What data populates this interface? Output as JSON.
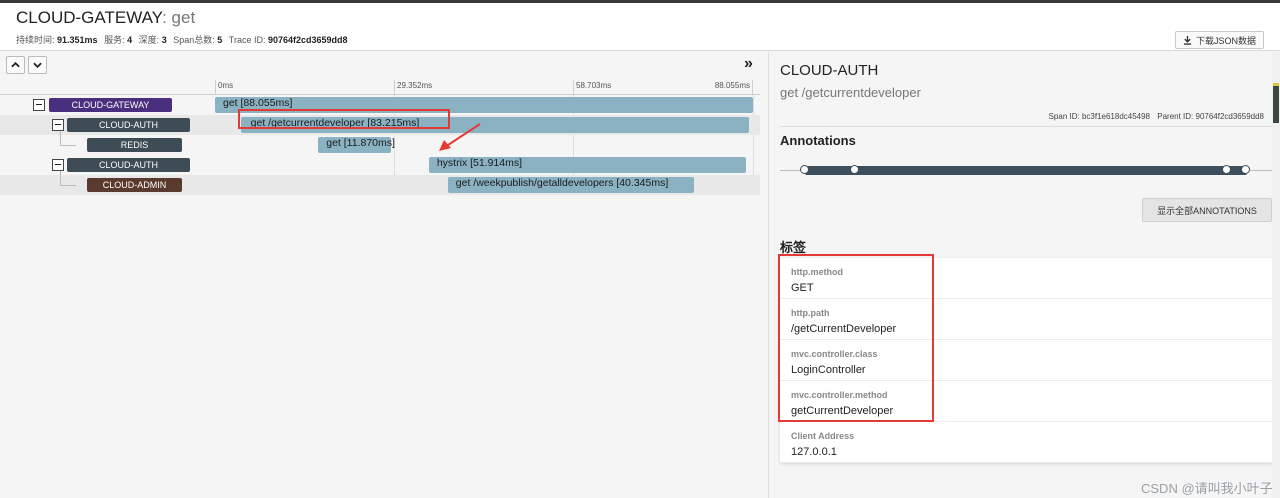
{
  "header": {
    "service": "CLOUD-GATEWAY",
    "operation": ": get",
    "info": [
      {
        "label": "持续时间:",
        "value": "91.351ms"
      },
      {
        "label": "服务:",
        "value": "4"
      },
      {
        "label": "深度:",
        "value": "3"
      },
      {
        "label": "Span总数:",
        "value": "5"
      },
      {
        "label": "Trace ID:",
        "value": "90764f2cd3659dd8"
      }
    ],
    "download_label": "下载JSON数据"
  },
  "timeline": {
    "expand_glyph": "»",
    "ticks": [
      "0ms",
      "29.352ms",
      "58.703ms",
      "88.055ms"
    ],
    "total_ms": 88.055
  },
  "spans": [
    {
      "service": "CLOUD-GATEWAY",
      "color": "#4b2f7f",
      "label": "get [88.055ms]",
      "start_ms": 0,
      "duration_ms": 88.055,
      "depth": 0,
      "collapsible": true
    },
    {
      "service": "CLOUD-AUTH",
      "color": "#3e4c56",
      "label": "get /getcurrentdeveloper [83.215ms]",
      "start_ms": 4.2,
      "duration_ms": 83.215,
      "depth": 1,
      "collapsible": true
    },
    {
      "service": "REDIS",
      "color": "#3e4c56",
      "label": "get [11.870ms]",
      "start_ms": 16.9,
      "duration_ms": 11.87,
      "depth": 2,
      "collapsible": false
    },
    {
      "service": "CLOUD-AUTH",
      "color": "#3e4c56",
      "label": "hystrix [51.914ms]",
      "start_ms": 35.0,
      "duration_ms": 51.914,
      "depth": 1,
      "collapsible": true
    },
    {
      "service": "CLOUD-ADMIN",
      "color": "#5b3a2e",
      "label": "get /weekpublish/getalldevelopers [40.345ms]",
      "start_ms": 38.1,
      "duration_ms": 40.345,
      "depth": 2,
      "collapsible": false
    }
  ],
  "detail": {
    "service": "CLOUD-AUTH",
    "operation": "get /getcurrentdeveloper",
    "span_id": "Span ID: bc3f1e618dc45498",
    "parent_id": "Parent ID: 90764f2cd3659dd8",
    "annotations_heading": "Annotations",
    "show_all_label": "显示全部ANNOTATIONS",
    "tags_heading": "标签",
    "tags": [
      {
        "key": "http.method",
        "value": "GET"
      },
      {
        "key": "http.path",
        "value": "/getCurrentDeveloper"
      },
      {
        "key": "mvc.controller.class",
        "value": "LoginController"
      },
      {
        "key": "mvc.controller.method",
        "value": "getCurrentDeveloper"
      },
      {
        "key": "Client Address",
        "value": "127.0.0.1"
      }
    ]
  },
  "watermark": "CSDN @请叫我小叶子"
}
